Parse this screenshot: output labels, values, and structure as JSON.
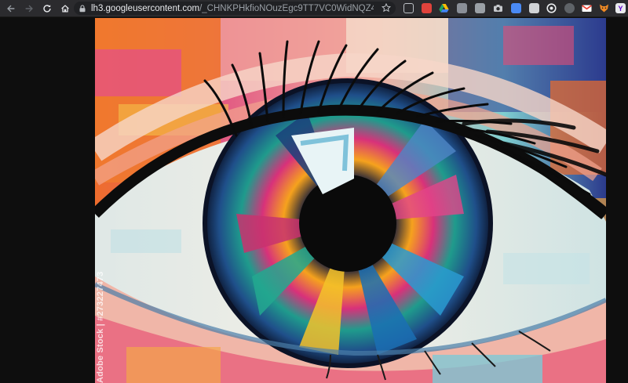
{
  "browser": {
    "url_host": "lh3.googleusercontent.com",
    "url_path": "/_CHNKPHkfioNOuzEgc9TT7VC0WidNQZ4aP_..."
  },
  "extensions": [
    {
      "name": "pocket-icon",
      "color": "#ef4056"
    },
    {
      "name": "cut-icon",
      "color": "#e0433c"
    },
    {
      "name": "drive-icon",
      "color": "#1fa463"
    },
    {
      "name": "ext-doc-icon",
      "color": "#8a8f98"
    },
    {
      "name": "ext-photo-icon",
      "color": "#9aa0a6"
    },
    {
      "name": "camera-icon",
      "color": "#c5c8cc"
    },
    {
      "name": "translate-icon",
      "color": "#4a8af4"
    },
    {
      "name": "ext-bag-icon",
      "color": "#d0d3d6"
    },
    {
      "name": "ext-circle-icon",
      "color": "#e8eaed"
    },
    {
      "name": "ext-dark-icon",
      "color": "#5f6368"
    },
    {
      "name": "gmail-icon",
      "color": "#ea4335"
    },
    {
      "name": "fox-icon",
      "color": "#f28b24"
    },
    {
      "name": "yahoo-icon",
      "color": "#e8eaed"
    }
  ],
  "image": {
    "watermark": "Adobe Stock | #273227473"
  }
}
